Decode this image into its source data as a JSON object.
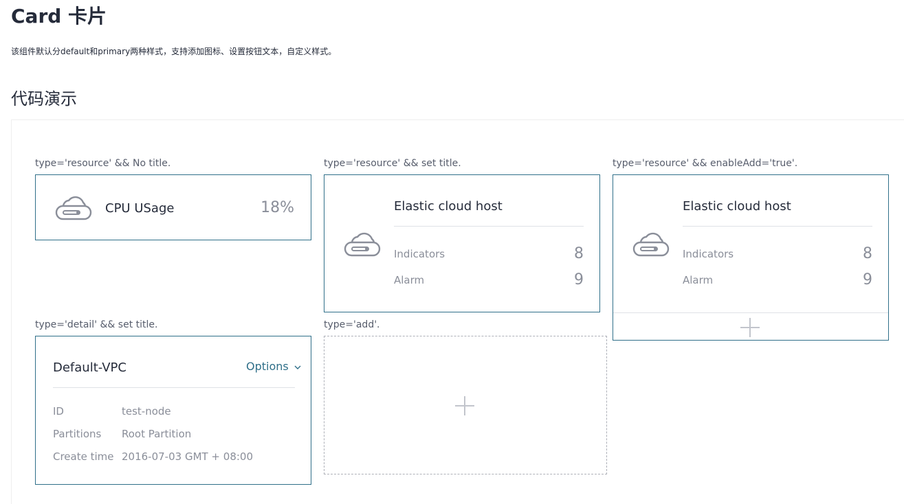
{
  "header": {
    "title": "Card 卡片",
    "description": "该组件默认分default和primary两种样式，支持添加图标、设置按钮文本，自定义样式。",
    "section_title": "代码演示"
  },
  "colors": {
    "card_border": "#2f6f89",
    "accent": "#2f6f89",
    "muted_text": "#8a8e99",
    "dashed_border": "#adb0b8"
  },
  "demos": {
    "resource_no_title": {
      "caption": "type='resource' && No title.",
      "icon": "cloud-host-icon",
      "label": "CPU USage",
      "value": "18%"
    },
    "resource_set_title": {
      "caption": "type='resource' && set title.",
      "icon": "cloud-host-icon",
      "title": "Elastic cloud host",
      "indicators": [
        {
          "label": "Indicators",
          "value": "8"
        },
        {
          "label": "Alarm",
          "value": "9"
        }
      ]
    },
    "resource_enable_add": {
      "caption": "type='resource' && enableAdd='true'.",
      "icon": "cloud-host-icon",
      "title": "Elastic cloud host",
      "indicators": [
        {
          "label": "Indicators",
          "value": "8"
        },
        {
          "label": "Alarm",
          "value": "9"
        }
      ],
      "add_icon": "plus-icon"
    },
    "detail_set_title": {
      "caption": "type='detail' && set title.",
      "title": "Default-VPC",
      "options_label": "Options",
      "options_icon": "chevron-down-icon",
      "rows": [
        {
          "label": "ID",
          "value": "test-node"
        },
        {
          "label": "Partitions",
          "value": "Root Partition"
        },
        {
          "label": "Create time",
          "value": "2016-07-03 GMT + 08:00"
        }
      ]
    },
    "add": {
      "caption": "type='add'.",
      "icon": "plus-icon"
    }
  }
}
